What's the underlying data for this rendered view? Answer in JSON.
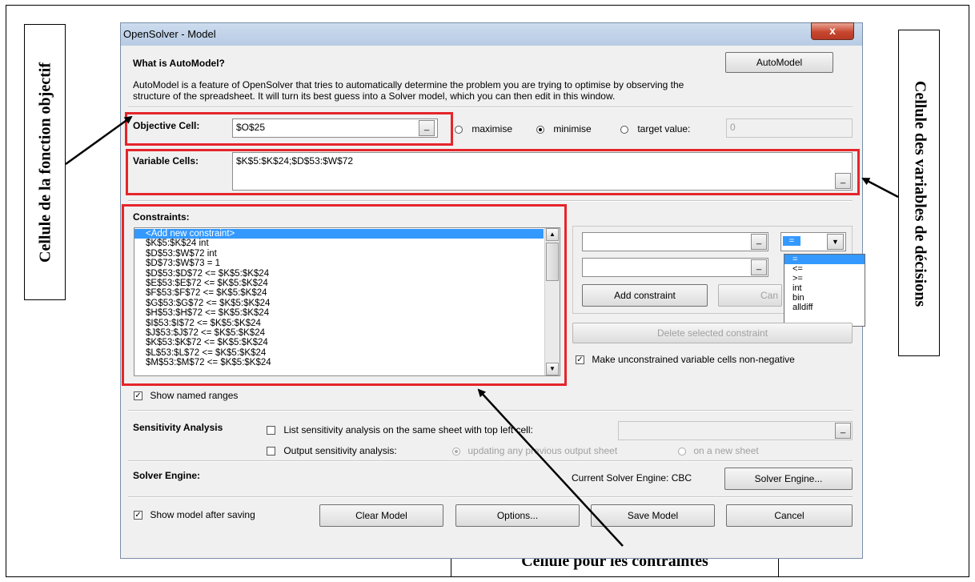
{
  "window": {
    "title": "OpenSolver - Model",
    "close_label": "x"
  },
  "automodel": {
    "heading": "What is AutoModel?",
    "button": "AutoModel",
    "description_line1": "AutoModel is a feature of OpenSolver that tries to automatically determine the problem you are trying to optimise by observing the",
    "description_line2": "structure of the spreadsheet. It will turn its best guess into a Solver model, which you can then edit in this window."
  },
  "objective": {
    "label": "Objective Cell:",
    "value": "$O$25",
    "select_button": "_",
    "options": [
      "maximise",
      "minimise",
      "target value:"
    ],
    "selected": "minimise",
    "target_value": "0"
  },
  "variables": {
    "label": "Variable Cells:",
    "value": "$K$5:$K$24;$D$53:$W$72",
    "select_button": "_"
  },
  "constraints": {
    "label": "Constraints:",
    "items": [
      "<Add new constraint>",
      "$K$5:$K$24 int",
      "$D$53:$W$72 int",
      "$D$73:$W$73 = 1",
      "$D$53:$D$72 <= $K$5:$K$24",
      "$E$53:$E$72 <= $K$5:$K$24",
      "$F$53:$F$72 <= $K$5:$K$24",
      "$G$53:$G$72 <= $K$5:$K$24",
      "$H$53:$H$72 <= $K$5:$K$24",
      "$I$53:$I$72 <= $K$5:$K$24",
      "$J$53:$J$72 <= $K$5:$K$24",
      "$K$53:$K$72 <= $K$5:$K$24",
      "$L$53:$L$72 <= $K$5:$K$24",
      "$M$53:$M$72 <= $K$5:$K$24"
    ],
    "selected_index": 0,
    "relation_value": "=",
    "relation_options": [
      "=",
      "<=",
      ">=",
      "int",
      "bin",
      "alldiff"
    ],
    "add_button": "Add constraint",
    "cancel_button": "Can",
    "delete_button": "Delete selected constraint",
    "nonneg_label": "Make unconstrained variable cells non-negative",
    "nonneg_checked": true,
    "show_named_ranges_label": "Show named ranges",
    "show_named_ranges_checked": true,
    "lhs_select": "_",
    "rhs_select": "_",
    "dropdown_arrow": "▼"
  },
  "sensitivity": {
    "heading": "Sensitivity Analysis",
    "list_label": "List sensitivity analysis on the same sheet with top left cell:",
    "output_label": "Output sensitivity analysis:",
    "opt_updating": "updating any previous output sheet",
    "opt_new": "on a new sheet",
    "select_button": "_"
  },
  "engine": {
    "heading": "Solver Engine:",
    "current": "Current Solver Engine: CBC",
    "button": "Solver Engine..."
  },
  "footer": {
    "show_model_label": "Show model after saving",
    "show_model_checked": true,
    "clear": "Clear Model",
    "options": "Options...",
    "save": "Save Model",
    "cancel": "Cancel"
  },
  "annotations": {
    "left": "Cellule de la fonction objectif",
    "right": "Cellule des variables de décisions",
    "bottom": "Cellule pour les contraintes"
  },
  "colors": {
    "highlight": "#e5252a",
    "selection": "#3399ff"
  }
}
